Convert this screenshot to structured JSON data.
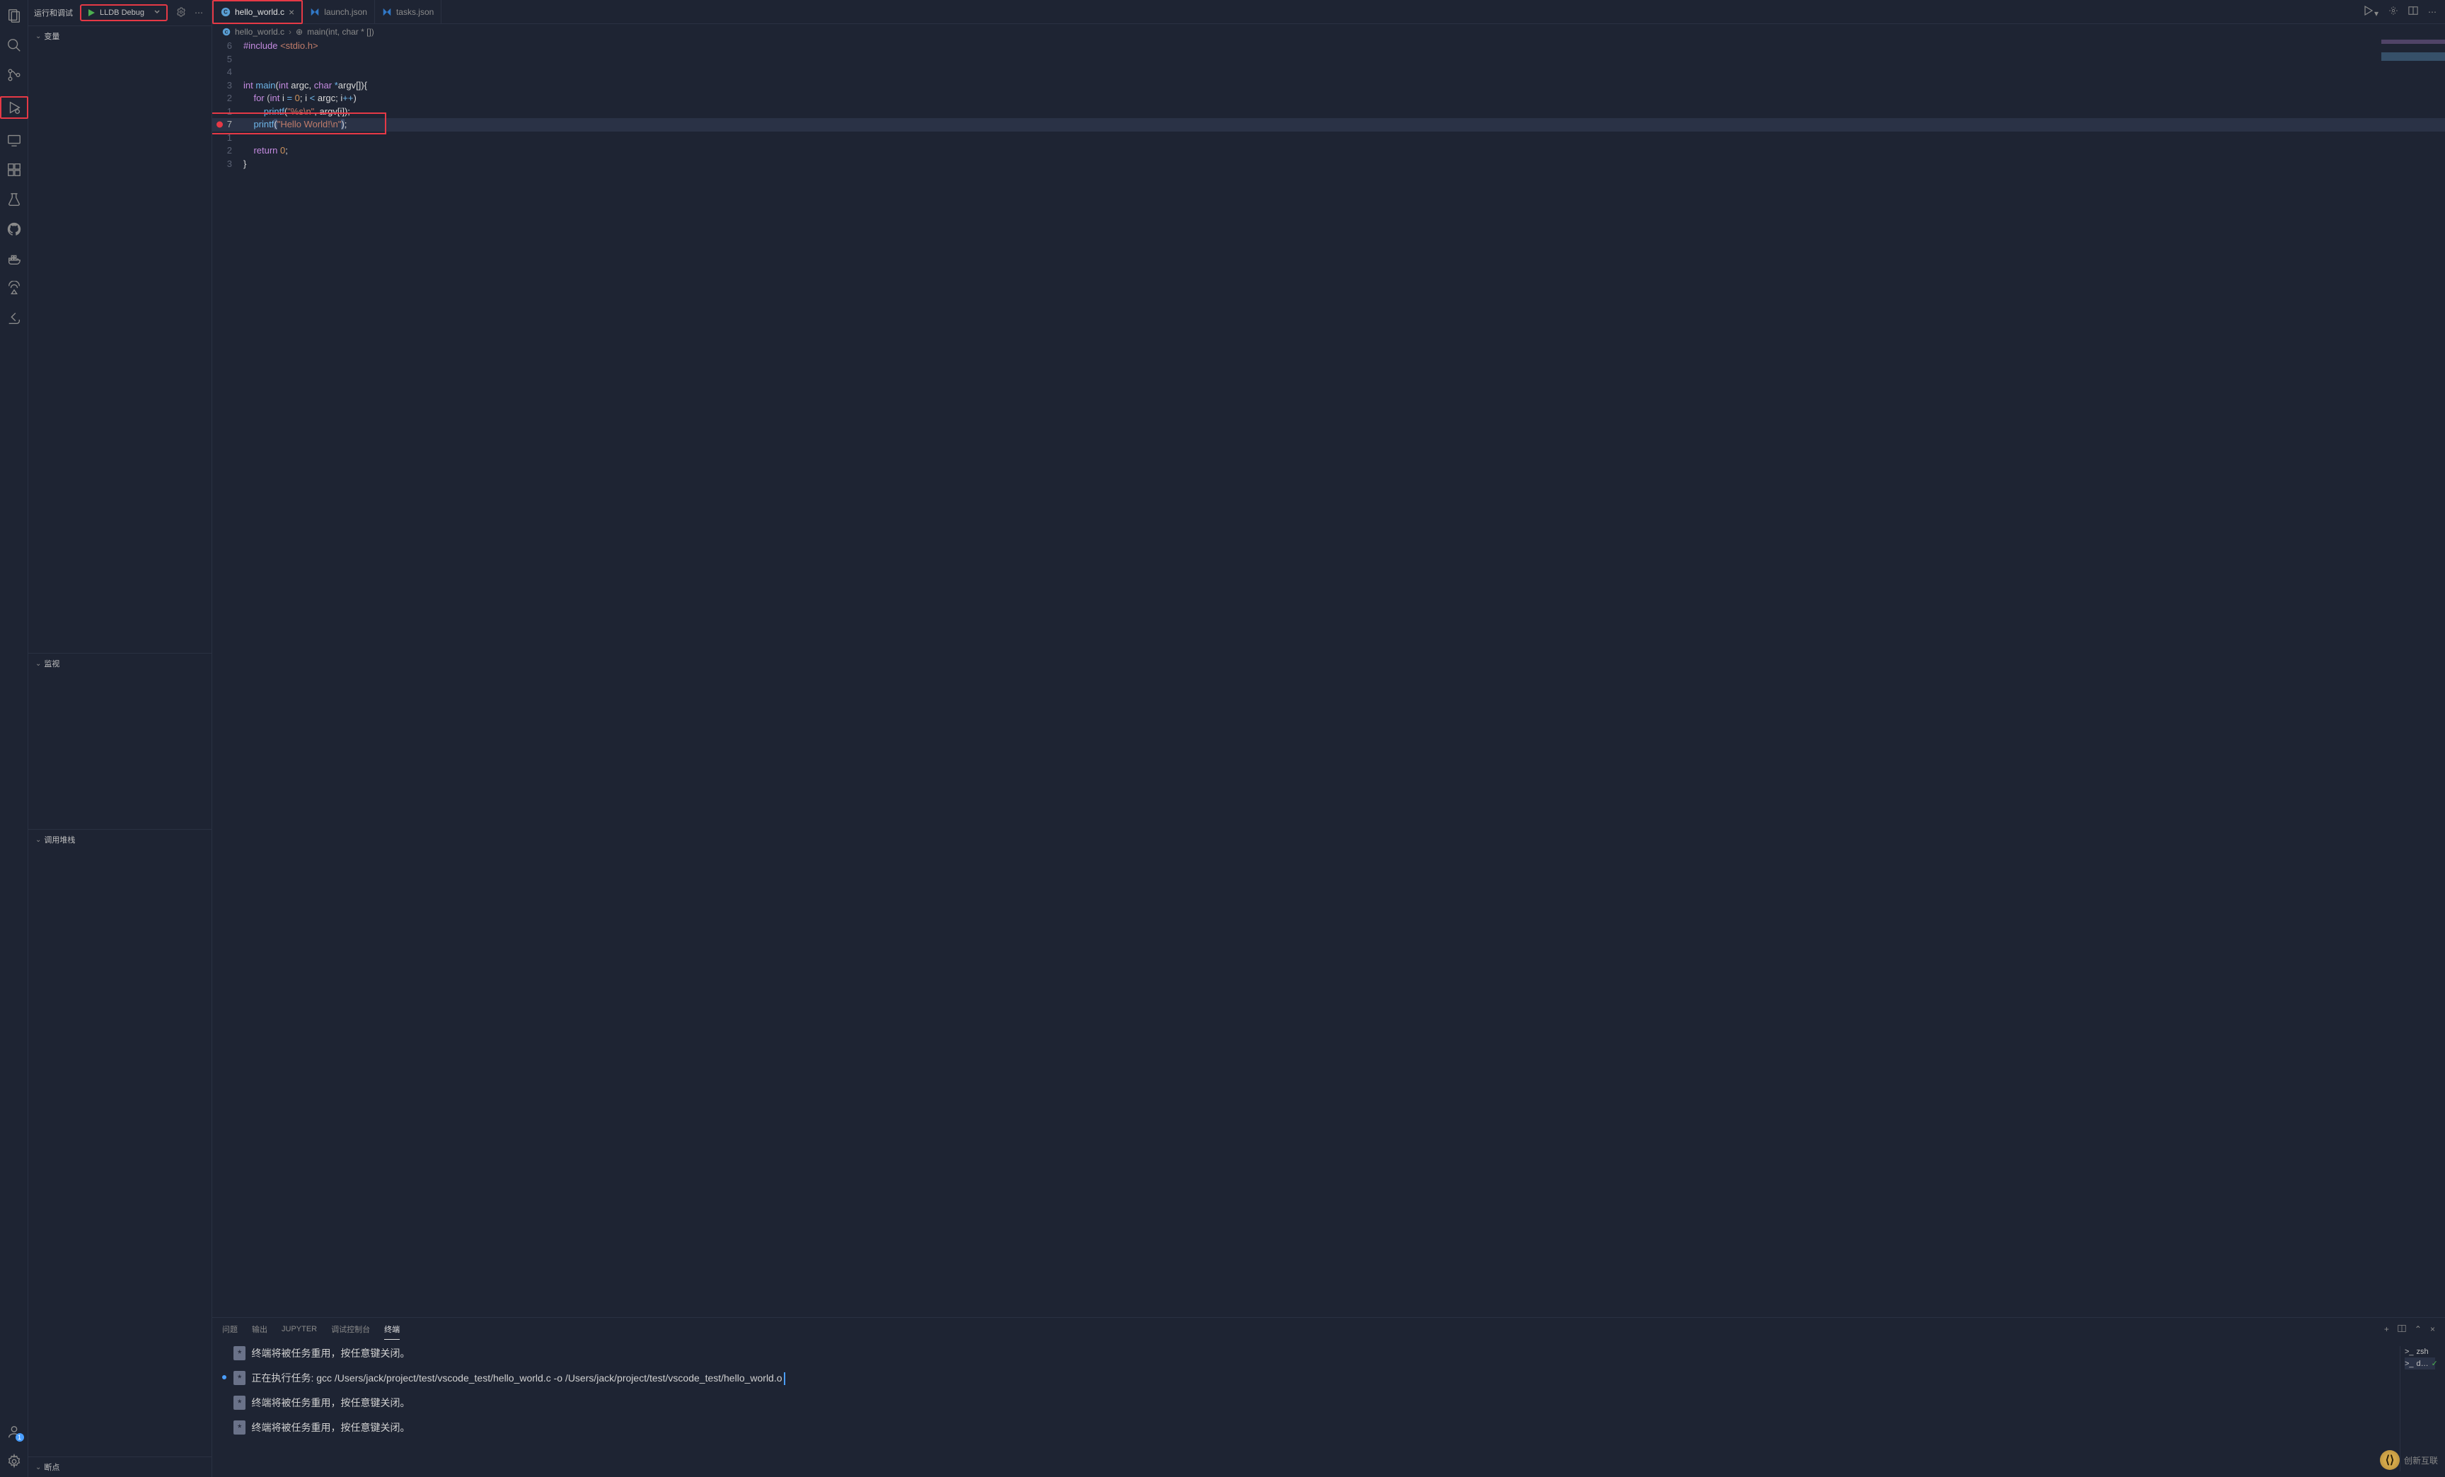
{
  "sidebar": {
    "title": "运行和调试",
    "config_name": "LLDB Debug",
    "sections": {
      "variables": "变量",
      "watch": "监视",
      "call_stack": "调用堆栈",
      "breakpoints": "断点"
    }
  },
  "tabs": [
    {
      "name": "hello_world.c",
      "icon": "c-file",
      "active": true
    },
    {
      "name": "launch.json",
      "icon": "json-file",
      "active": false
    },
    {
      "name": "tasks.json",
      "icon": "json-file",
      "active": false
    }
  ],
  "breadcrumb": {
    "file": "hello_world.c",
    "symbol": "main(int, char * [])"
  },
  "code": {
    "lines": [
      {
        "num": "6",
        "tokens": [
          {
            "cls": "preproc",
            "t": "#include"
          },
          {
            "cls": "",
            "t": " "
          },
          {
            "cls": "incfile",
            "t": "<stdio.h>"
          }
        ]
      },
      {
        "num": "5",
        "tokens": []
      },
      {
        "num": "4",
        "tokens": []
      },
      {
        "num": "3",
        "tokens": [
          {
            "cls": "type",
            "t": "int"
          },
          {
            "cls": "",
            "t": " "
          },
          {
            "cls": "fn",
            "t": "main"
          },
          {
            "cls": "punct",
            "t": "("
          },
          {
            "cls": "type",
            "t": "int"
          },
          {
            "cls": "",
            "t": " "
          },
          {
            "cls": "var",
            "t": "argc"
          },
          {
            "cls": "punct",
            "t": ", "
          },
          {
            "cls": "type",
            "t": "char"
          },
          {
            "cls": "",
            "t": " "
          },
          {
            "cls": "op",
            "t": "*"
          },
          {
            "cls": "var",
            "t": "argv"
          },
          {
            "cls": "punct",
            "t": "[]){"
          }
        ]
      },
      {
        "num": "2",
        "tokens": [
          {
            "cls": "",
            "t": "    "
          },
          {
            "cls": "kw",
            "t": "for"
          },
          {
            "cls": "",
            "t": " ("
          },
          {
            "cls": "type",
            "t": "int"
          },
          {
            "cls": "",
            "t": " "
          },
          {
            "cls": "var",
            "t": "i"
          },
          {
            "cls": "",
            "t": " "
          },
          {
            "cls": "op",
            "t": "="
          },
          {
            "cls": "",
            "t": " "
          },
          {
            "cls": "num",
            "t": "0"
          },
          {
            "cls": "punct",
            "t": "; "
          },
          {
            "cls": "var",
            "t": "i"
          },
          {
            "cls": "",
            "t": " "
          },
          {
            "cls": "op",
            "t": "<"
          },
          {
            "cls": "",
            "t": " "
          },
          {
            "cls": "var",
            "t": "argc"
          },
          {
            "cls": "punct",
            "t": "; "
          },
          {
            "cls": "var",
            "t": "i"
          },
          {
            "cls": "op",
            "t": "++"
          },
          {
            "cls": "punct",
            "t": ")"
          }
        ]
      },
      {
        "num": "1",
        "tokens": [
          {
            "cls": "",
            "t": "        "
          },
          {
            "cls": "fn",
            "t": "printf"
          },
          {
            "cls": "punct",
            "t": "("
          },
          {
            "cls": "str",
            "t": "\"%s\\n\""
          },
          {
            "cls": "punct",
            "t": ", "
          },
          {
            "cls": "var",
            "t": "argv"
          },
          {
            "cls": "punct",
            "t": "["
          },
          {
            "cls": "var",
            "t": "i"
          },
          {
            "cls": "punct",
            "t": "]);"
          }
        ]
      },
      {
        "num": "7",
        "breakpoint": true,
        "highlighted": true,
        "redbox": true,
        "tokens": [
          {
            "cls": "",
            "t": "    "
          },
          {
            "cls": "fn",
            "t": "printf"
          },
          {
            "cls": "punct paren-match",
            "t": "("
          },
          {
            "cls": "str",
            "t": "\"Hello World!\\n\""
          },
          {
            "cls": "punct paren-match",
            "t": ")"
          },
          {
            "cls": "punct",
            "t": ";"
          }
        ]
      },
      {
        "num": "1",
        "tokens": []
      },
      {
        "num": "2",
        "tokens": [
          {
            "cls": "",
            "t": "    "
          },
          {
            "cls": "kw",
            "t": "return"
          },
          {
            "cls": "",
            "t": " "
          },
          {
            "cls": "num",
            "t": "0"
          },
          {
            "cls": "punct",
            "t": ";"
          }
        ]
      },
      {
        "num": "3",
        "tokens": [
          {
            "cls": "punct",
            "t": "}"
          }
        ]
      }
    ]
  },
  "panel": {
    "tabs": {
      "problems": "问题",
      "output": "输出",
      "jupyter": "JUPYTER",
      "debug_console": "调试控制台",
      "terminal": "终端"
    },
    "terminal": {
      "lines": [
        {
          "marker": "",
          "badge": "*",
          "text": "终端将被任务重用，按任意键关闭。"
        },
        {
          "marker": "blue",
          "badge": "*",
          "text": "正在执行任务: gcc /Users/jack/project/test/vscode_test/hello_world.c -o /Users/jack/project/test/vscode_test/hello_world.o"
        },
        {
          "marker": "",
          "badge": "*",
          "text": "终端将被任务重用，按任意键关闭。"
        },
        {
          "marker": "",
          "badge": "*",
          "text": "终端将被任务重用，按任意键关闭。"
        }
      ],
      "side": [
        {
          "icon": "▸",
          "name": "zsh"
        },
        {
          "icon": "▸",
          "name": "d…",
          "check": true
        }
      ]
    }
  },
  "account_badge": "1",
  "watermark": "创新互联"
}
